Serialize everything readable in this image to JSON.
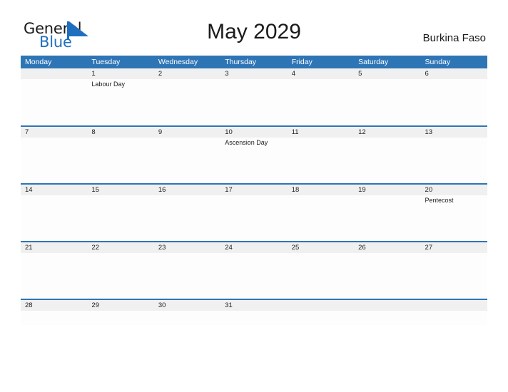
{
  "brand": {
    "word_one": "General",
    "word_two": "Blue",
    "flag_icon": "blue-triangle-flag-icon",
    "accent_color": "#1f6fc0"
  },
  "header": {
    "title": "May 2029",
    "country": "Burkina Faso"
  },
  "theme": {
    "header_blue": "#2e75b6",
    "date_band_gray": "#f0f0f0",
    "row_divider": "#2e75b6",
    "text_dark": "#202020"
  },
  "calendar": {
    "weekdays": [
      "Monday",
      "Tuesday",
      "Wednesday",
      "Thursday",
      "Friday",
      "Saturday",
      "Sunday"
    ],
    "weeks": [
      {
        "days": [
          {
            "date": "",
            "event": ""
          },
          {
            "date": "1",
            "event": "Labour Day"
          },
          {
            "date": "2",
            "event": ""
          },
          {
            "date": "3",
            "event": ""
          },
          {
            "date": "4",
            "event": ""
          },
          {
            "date": "5",
            "event": ""
          },
          {
            "date": "6",
            "event": ""
          }
        ]
      },
      {
        "days": [
          {
            "date": "7",
            "event": ""
          },
          {
            "date": "8",
            "event": ""
          },
          {
            "date": "9",
            "event": ""
          },
          {
            "date": "10",
            "event": "Ascension Day"
          },
          {
            "date": "11",
            "event": ""
          },
          {
            "date": "12",
            "event": ""
          },
          {
            "date": "13",
            "event": ""
          }
        ]
      },
      {
        "days": [
          {
            "date": "14",
            "event": ""
          },
          {
            "date": "15",
            "event": ""
          },
          {
            "date": "16",
            "event": ""
          },
          {
            "date": "17",
            "event": ""
          },
          {
            "date": "18",
            "event": ""
          },
          {
            "date": "19",
            "event": ""
          },
          {
            "date": "20",
            "event": "Pentecost"
          }
        ]
      },
      {
        "days": [
          {
            "date": "21",
            "event": ""
          },
          {
            "date": "22",
            "event": ""
          },
          {
            "date": "23",
            "event": ""
          },
          {
            "date": "24",
            "event": ""
          },
          {
            "date": "25",
            "event": ""
          },
          {
            "date": "26",
            "event": ""
          },
          {
            "date": "27",
            "event": ""
          }
        ]
      },
      {
        "days": [
          {
            "date": "28",
            "event": ""
          },
          {
            "date": "29",
            "event": ""
          },
          {
            "date": "30",
            "event": ""
          },
          {
            "date": "31",
            "event": ""
          },
          {
            "date": "",
            "event": ""
          },
          {
            "date": "",
            "event": ""
          },
          {
            "date": "",
            "event": ""
          }
        ]
      }
    ]
  }
}
